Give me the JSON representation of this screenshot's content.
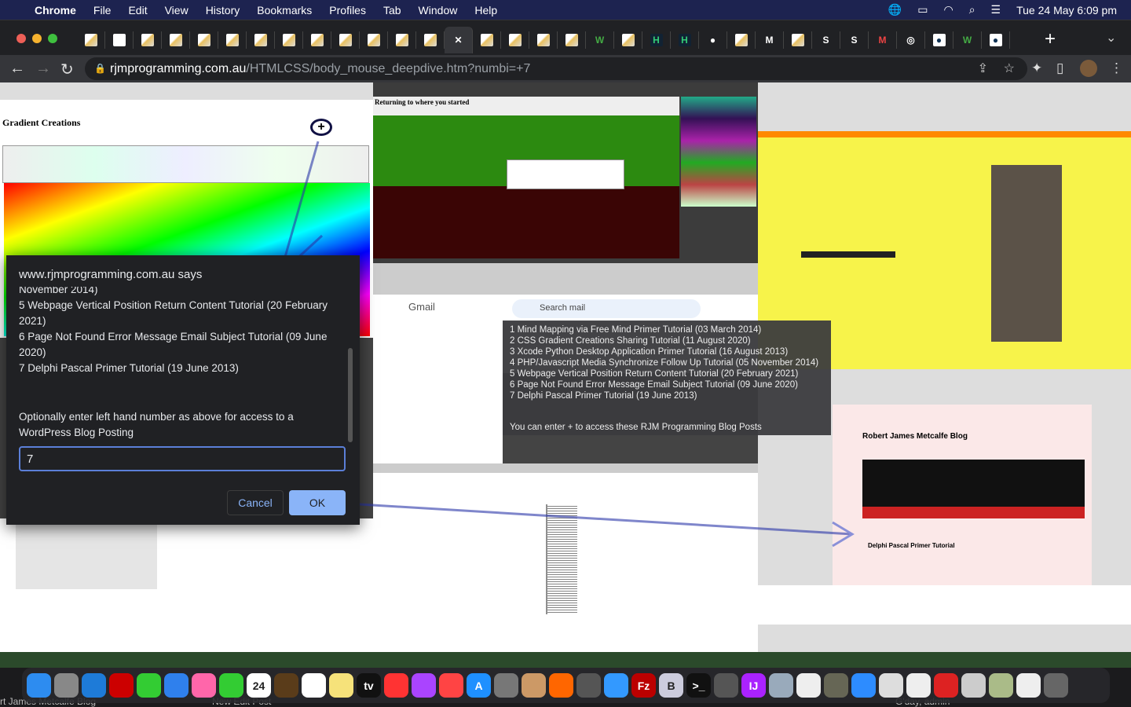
{
  "menubar": {
    "app": "Chrome",
    "items": [
      "File",
      "Edit",
      "View",
      "History",
      "Bookmarks",
      "Profiles",
      "Tab",
      "Window",
      "Help"
    ],
    "datetime": "Tue 24 May  6:09 pm"
  },
  "tabs": [
    "rjm",
    "blank",
    "rjm",
    "rjm",
    "rjm",
    "rjm",
    "rjm",
    "rjm",
    "rjm",
    "rjm",
    "rjm",
    "rjm",
    "rjm",
    "active",
    "rjm",
    "rjm",
    "rjm",
    "rjm",
    "w3",
    "rjm",
    "H",
    "H",
    "elephant",
    "rjm",
    "M",
    "rjm",
    "S",
    "S",
    "gmail",
    "chrome",
    "rjm-app",
    "w3",
    "rjm-app"
  ],
  "tab_glyphs": {
    "w3": "W",
    "H": "H",
    "M": "M",
    "S": "S",
    "gmail": "M",
    "chrome": "◎",
    "elephant": "●",
    "rjm-app": "●",
    "active": "✕"
  },
  "address": {
    "host": "rjmprogramming.com.au",
    "path": "/HTMLCSS/body_mouse_deepdive.htm?numbi=+7"
  },
  "dialog": {
    "title": "www.rjmprogramming.com.au says",
    "lines": [
      "November 2014)",
      " 5 Webpage Vertical Position Return Content Tutorial (20 February 2021)",
      " 6 Page Not Found Error Message Email Subject Tutorial (09 June 2020)",
      " 7 Delphi Pascal Primer Tutorial (19 June 2013)"
    ],
    "prompt": "Optionally enter left hand number as above for access to a WordPress Blog Posting",
    "input_value": "7",
    "cancel": "Cancel",
    "ok": "OK"
  },
  "tooltip": {
    "lines": [
      "1 Mind Mapping via Free Mind Primer Tutorial (03 March 2014)",
      "2 CSS Gradient Creations Sharing Tutorial (11 August 2020)",
      "3 Xcode Python Desktop Application Primer Tutorial (16 August 2013)",
      "4 PHP/Javascript Media Synchronize Follow Up Tutorial (05 November 2014)",
      "5 Webpage Vertical Position Return Content Tutorial (20 February 2021)",
      "6 Page Not Found Error Message Email Subject Tutorial (09 June 2020)",
      "7 Delphi Pascal Primer Tutorial (19 June 2013)"
    ],
    "footer": "You can enter + to access these RJM Programming Blog Posts"
  },
  "collage": {
    "gradient_title": "Gradient Creations",
    "blog_title": "Robert James Metcalfe Blog",
    "delphi_heading": "Delphi Pascal Primer Tutorial",
    "gmail_label": "Gmail",
    "search_mail": "Search mail",
    "returning": "Returning to where you started"
  },
  "dock": [
    {
      "n": "finder",
      "c": "#2d8cf0"
    },
    {
      "n": "launchpad",
      "c": "#888"
    },
    {
      "n": "safari",
      "c": "#1e7bd8"
    },
    {
      "n": "opera",
      "c": "#c00"
    },
    {
      "n": "messages",
      "c": "#3c3"
    },
    {
      "n": "mail",
      "c": "#2f80ed"
    },
    {
      "n": "photos",
      "c": "#f6a"
    },
    {
      "n": "facetime",
      "c": "#3c3"
    },
    {
      "n": "calendar",
      "c": "#fff",
      "t": "24"
    },
    {
      "n": "app",
      "c": "#5a3c1a"
    },
    {
      "n": "reminders",
      "c": "#fff"
    },
    {
      "n": "notes",
      "c": "#f6e27a"
    },
    {
      "n": "tv",
      "c": "#111",
      "t": "tv"
    },
    {
      "n": "music",
      "c": "#f33"
    },
    {
      "n": "podcasts",
      "c": "#a4f"
    },
    {
      "n": "news",
      "c": "#f44"
    },
    {
      "n": "app-store",
      "c": "#1e90ff",
      "t": "A"
    },
    {
      "n": "system-preferences",
      "c": "#777"
    },
    {
      "n": "paint",
      "c": "#c96"
    },
    {
      "n": "firefox",
      "c": "#f60"
    },
    {
      "n": "calculator",
      "c": "#555"
    },
    {
      "n": "xcode",
      "c": "#39f"
    },
    {
      "n": "filezilla",
      "c": "#b00",
      "t": "Fz"
    },
    {
      "n": "bbedit",
      "c": "#ccd",
      "t": "B"
    },
    {
      "n": "terminal",
      "c": "#111",
      "t": ">_"
    },
    {
      "n": "mastodon",
      "c": "#555"
    },
    {
      "n": "intellij",
      "c": "#a2f",
      "t": "IJ"
    },
    {
      "n": "preview",
      "c": "#9ab"
    },
    {
      "n": "file",
      "c": "#eee"
    },
    {
      "n": "gimp",
      "c": "#665"
    },
    {
      "n": "zoom",
      "c": "#2d8cff"
    },
    {
      "n": "chrome",
      "c": "#ddd"
    },
    {
      "n": "textedit",
      "c": "#eee"
    },
    {
      "n": "acrobat",
      "c": "#d22"
    },
    {
      "n": "doc",
      "c": "#ccc"
    },
    {
      "n": "image",
      "c": "#ab8"
    },
    {
      "n": "doc2",
      "c": "#eee"
    },
    {
      "n": "trash",
      "c": "#666"
    }
  ],
  "below_dock": {
    "left": "rt James Metcalfe Blog",
    "mid": "New   Edit Post",
    "right": "G'day, admin"
  }
}
